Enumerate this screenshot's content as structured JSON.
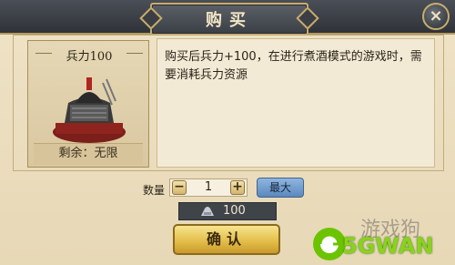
{
  "dialog": {
    "title": "购买",
    "close_glyph": "×"
  },
  "item": {
    "name": "兵力100",
    "remaining": "剩余：无限",
    "description": "购买后兵力+100，在进行煮酒模式的游戏时，需要消耗兵力资源"
  },
  "quantity": {
    "label": "数量",
    "minus_glyph": "−",
    "value": "1",
    "plus_glyph": "+",
    "max_label": "最大"
  },
  "cost": {
    "icon": "troop-icon",
    "value": "100"
  },
  "confirm_label": "确认",
  "watermark": {
    "brand": "5GWAN",
    "top_text": "游戏狗"
  },
  "colors": {
    "panel_bg": "#efe3c7",
    "frame_gold": "#c9ac6c",
    "confirm_gold": "#e2bb46",
    "max_blue": "#6f9ccf"
  }
}
